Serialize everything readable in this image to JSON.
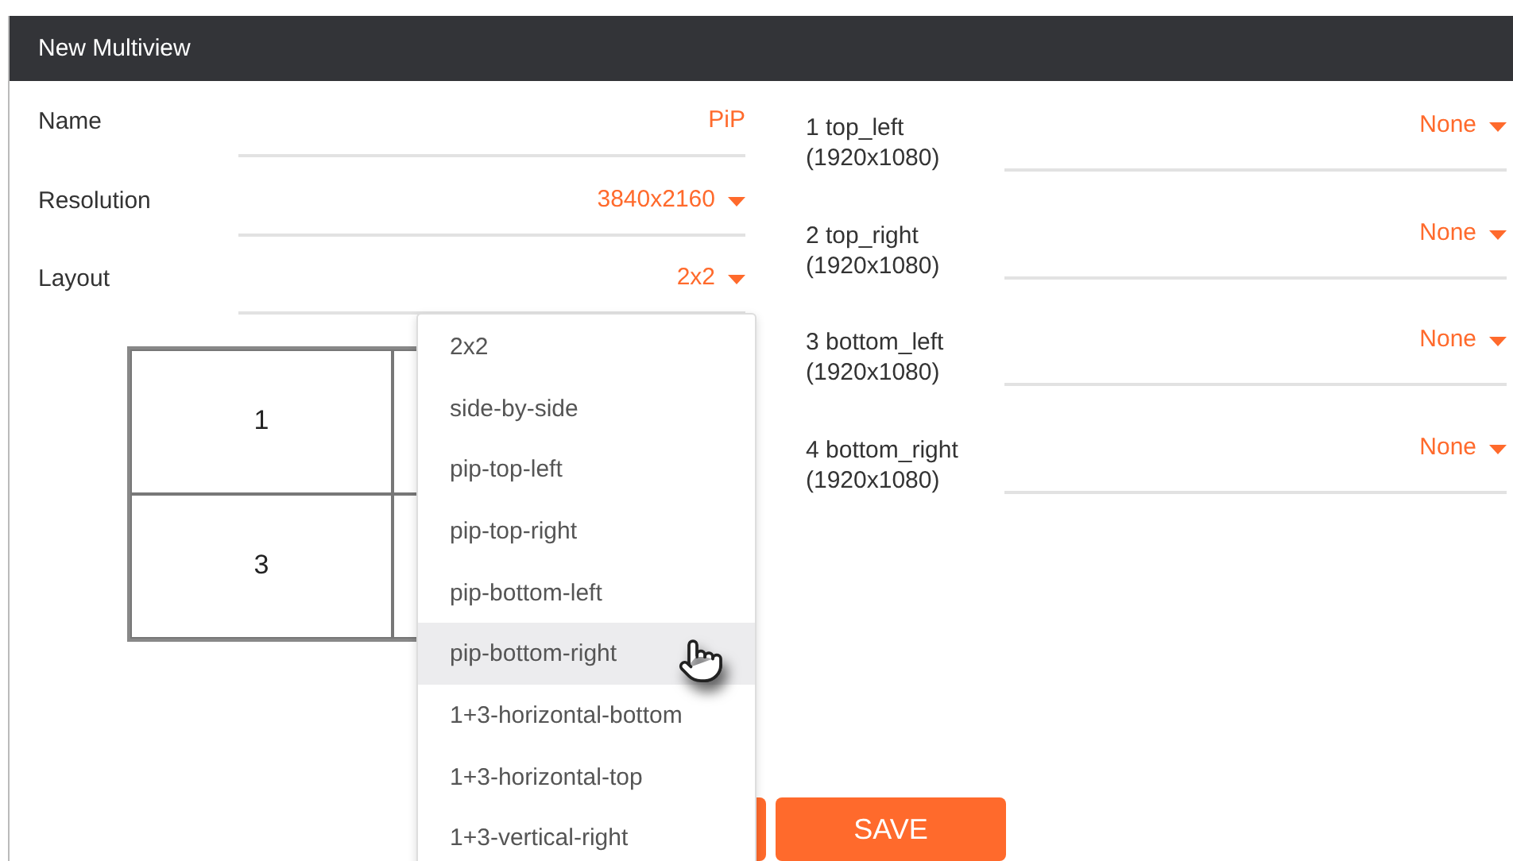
{
  "window": {
    "title": "New Multiview"
  },
  "fields": [
    {
      "label": "Name",
      "value": "PiP",
      "kind": "text"
    },
    {
      "label": "Resolution",
      "value": "3840x2160",
      "kind": "select"
    },
    {
      "label": "Layout",
      "value": "2x2",
      "kind": "select"
    }
  ],
  "layout_preview": {
    "cells": [
      "1",
      "3"
    ]
  },
  "layout_dropdown": {
    "options": [
      {
        "label": "2x2",
        "highlighted": false
      },
      {
        "label": "side-by-side",
        "highlighted": false
      },
      {
        "label": "pip-top-left",
        "highlighted": false
      },
      {
        "label": "pip-top-right",
        "highlighted": false
      },
      {
        "label": "pip-bottom-left",
        "highlighted": false
      },
      {
        "label": "pip-bottom-right",
        "highlighted": true
      },
      {
        "label": "1+3-horizontal-bottom",
        "highlighted": false
      },
      {
        "label": "1+3-horizontal-top",
        "highlighted": false
      },
      {
        "label": "1+3-vertical-right",
        "highlighted": false
      }
    ]
  },
  "sources": [
    {
      "label": "1 top_left",
      "resolution": "(1920x1080)",
      "value": "None"
    },
    {
      "label": "2 top_right",
      "resolution": "(1920x1080)",
      "value": "None"
    },
    {
      "label": "3 bottom_left",
      "resolution": "(1920x1080)",
      "value": "None"
    },
    {
      "label": "4 bottom_right",
      "resolution": "(1920x1080)",
      "value": "None"
    }
  ],
  "buttons": [
    {
      "kind": "hidden"
    },
    {
      "label": "SAVE",
      "kind": "primary"
    }
  ]
}
